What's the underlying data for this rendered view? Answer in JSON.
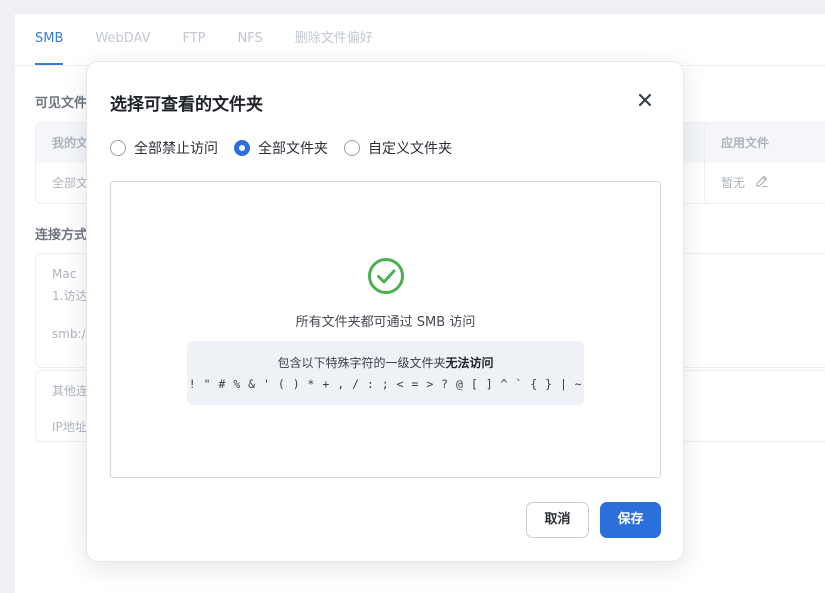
{
  "background": {
    "tabs": [
      {
        "label": "SMB",
        "active": true
      },
      {
        "label": "WebDAV",
        "active": false
      },
      {
        "label": "FTP",
        "active": false
      },
      {
        "label": "NFS",
        "active": false
      },
      {
        "label": "删除文件偏好",
        "active": false
      }
    ],
    "section_visible": "可见文件",
    "card_left_head": "我的文",
    "card_left_body": "全部文",
    "card_right_head": "应用文件",
    "card_right_body": "暂无",
    "section_connect": "连接方式",
    "mac_title": "Mac",
    "mac_line": "1.访达",
    "mac_smb": "smb:/",
    "other_title": "其他连",
    "other_line": "IP地址"
  },
  "dialog": {
    "title": "选择可查看的文件夹",
    "radio_options": [
      {
        "label": "全部禁止访问",
        "checked": false
      },
      {
        "label": "全部文件夹",
        "checked": true
      },
      {
        "label": "自定义文件夹",
        "checked": false
      }
    ],
    "info_text": "所有文件夹都可通过 SMB 访问",
    "notice_prefix": "包含以下特殊字符的一级文件夹",
    "notice_bold": "无法访问",
    "special_chars": "! \" # % & ' ( ) * + , / : ; < = > ? @ [ ] ^ ` { } | ~",
    "cancel_label": "取消",
    "save_label": "保存"
  },
  "colors": {
    "accent": "#2a6fdb",
    "success": "#4caf50"
  }
}
